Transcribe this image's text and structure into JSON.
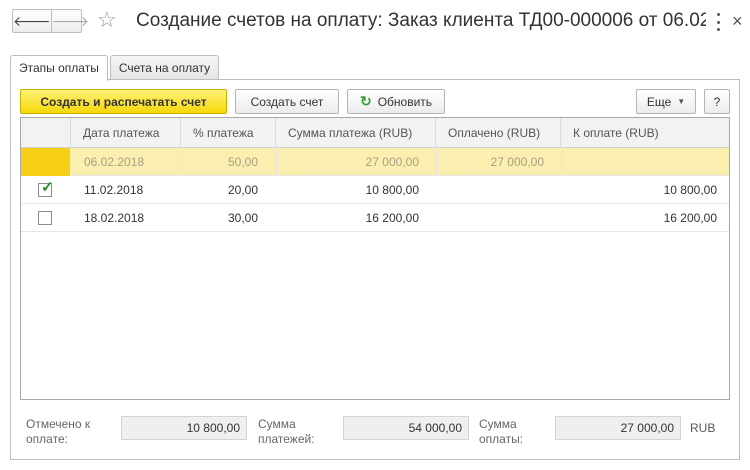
{
  "window": {
    "title": "Создание счетов на оплату: Заказ клиента ТД00-000006 от 06.02.20...",
    "back_glyph": "🡐",
    "forward_glyph": "🡒",
    "star_glyph": "☆",
    "close_glyph": "×"
  },
  "tabs": [
    {
      "label": "Этапы оплаты",
      "active": true
    },
    {
      "label": "Счета на оплату",
      "active": false
    }
  ],
  "toolbar": {
    "create_print_label": "Создать и распечатать счет",
    "create_label": "Создать счет",
    "refresh_label": "Обновить",
    "more_label": "Еще",
    "help_label": "?"
  },
  "table": {
    "columns": [
      "Дата платежа",
      "% платежа",
      "Сумма платежа (RUB)",
      "Оплачено (RUB)",
      "К оплате (RUB)"
    ],
    "rows": [
      {
        "checked": null,
        "date": "06.02.2018",
        "percent": "50,00",
        "amount": "27 000,00",
        "paid": "27 000,00",
        "to_pay": "",
        "highlight": true
      },
      {
        "checked": true,
        "date": "11.02.2018",
        "percent": "20,00",
        "amount": "10 800,00",
        "paid": "",
        "to_pay": "10 800,00",
        "highlight": false
      },
      {
        "checked": false,
        "date": "18.02.2018",
        "percent": "30,00",
        "amount": "16 200,00",
        "paid": "",
        "to_pay": "16 200,00",
        "highlight": false
      }
    ]
  },
  "footer": {
    "marked_label_1": "Отмечено к",
    "marked_label_2": "оплате:",
    "marked_value": "10 800,00",
    "payments_label_1": "Сумма",
    "payments_label_2": "платежей:",
    "payments_value": "54 000,00",
    "paid_label_1": "Сумма",
    "paid_label_2": "оплаты:",
    "paid_value": "27 000,00",
    "currency": "RUB"
  },
  "colors": {
    "primary_button": "#f5d80a",
    "highlight_row": "#fbefb0",
    "check_green": "#2e8b2e"
  }
}
